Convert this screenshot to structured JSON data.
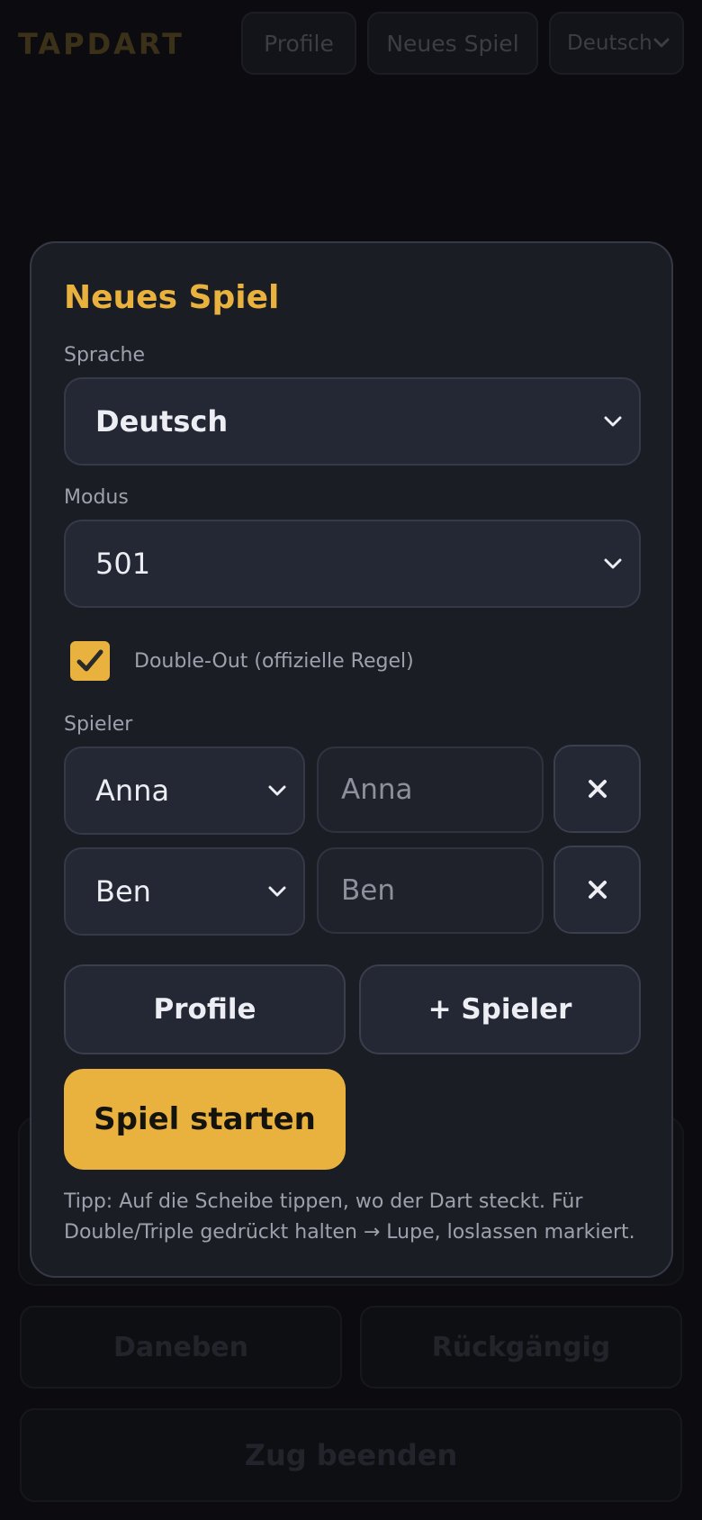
{
  "app": {
    "logo": "TAPDART",
    "nav": {
      "profile_label": "Profile",
      "new_game_label": "Neues Spiel",
      "language_value": "Deutsch"
    },
    "controls": {
      "miss_label": "Daneben",
      "undo_label": "Rückgängig",
      "end_turn_label": "Zug beenden"
    }
  },
  "modal": {
    "title": "Neues Spiel",
    "language_label": "Sprache",
    "language_value": "Deutsch",
    "mode_label": "Modus",
    "mode_value": "501",
    "double_out_label": "Double-Out (offizielle Regel)",
    "double_out_checked": true,
    "players_label": "Spieler",
    "players": [
      {
        "profile": "Anna",
        "name_placeholder": "Anna"
      },
      {
        "profile": "Ben",
        "name_placeholder": "Ben"
      }
    ],
    "profile_button": "Profile",
    "add_player_button": "+ Spieler",
    "start_button": "Spiel starten",
    "tip": "Tipp: Auf die Scheibe tippen, wo der Dart steckt. Für Double/Triple gedrückt halten → Lupe, loslassen markiert."
  },
  "colors": {
    "accent": "#e9b23f",
    "modal_bg": "#1b1d24",
    "page_bg": "#0c0c10"
  },
  "icons": [
    "chevron-down-icon",
    "close-icon",
    "checkmark-icon"
  ]
}
